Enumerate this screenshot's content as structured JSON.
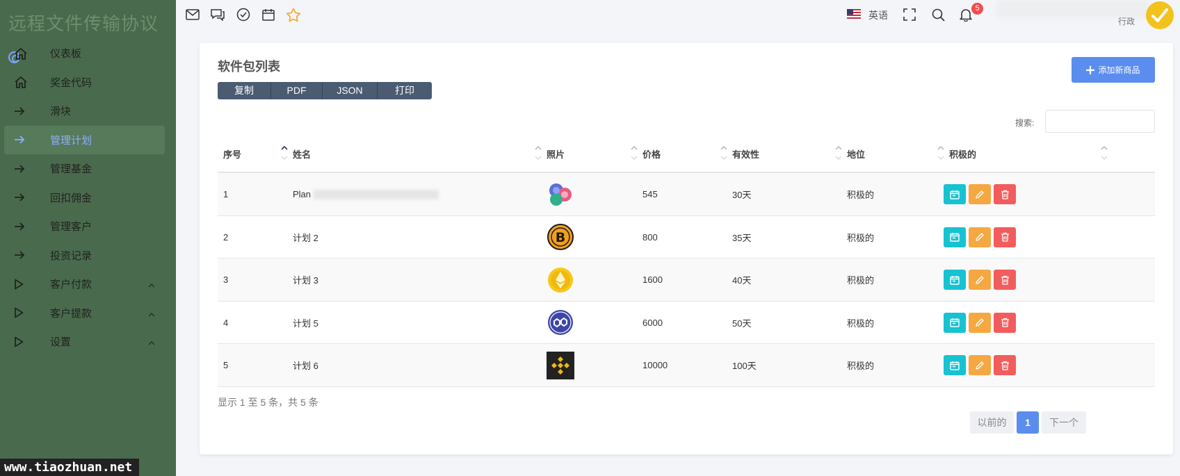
{
  "app": {
    "brand": "远程文件传输协议",
    "watermark": "www.tiaozhuan.net"
  },
  "sidebar": {
    "items": [
      {
        "label": "仪表板",
        "icon": "home-icon",
        "active": false,
        "caret": false
      },
      {
        "label": "奖金代码",
        "icon": "home-icon",
        "active": false,
        "caret": false
      },
      {
        "label": "滑块",
        "icon": "arrow-right-icon",
        "active": false,
        "caret": false
      },
      {
        "label": "管理计划",
        "icon": "arrow-right-icon",
        "active": true,
        "caret": false
      },
      {
        "label": "管理基金",
        "icon": "arrow-right-icon",
        "active": false,
        "caret": false
      },
      {
        "label": "回扣佣金",
        "icon": "arrow-right-icon",
        "active": false,
        "caret": false
      },
      {
        "label": "管理客户",
        "icon": "arrow-right-icon",
        "active": false,
        "caret": false
      },
      {
        "label": "投资记录",
        "icon": "arrow-right-icon",
        "active": false,
        "caret": false
      },
      {
        "label": "客户付款",
        "icon": "play-icon",
        "active": false,
        "caret": true
      },
      {
        "label": "客户提款",
        "icon": "play-icon",
        "active": false,
        "caret": true
      },
      {
        "label": "设置",
        "icon": "play-icon",
        "active": false,
        "caret": true
      }
    ]
  },
  "topbar": {
    "icons": [
      "mail-icon",
      "chat-icon",
      "check-circle-icon",
      "calendar-icon",
      "star-icon"
    ],
    "language": "英语",
    "notification_count": "5",
    "user_role": "行政"
  },
  "page": {
    "title": "软件包列表",
    "export_buttons": [
      "复制",
      "PDF",
      "JSON",
      "打印"
    ],
    "add_button": "添加新商品",
    "search_label": "搜索:",
    "search_value": ""
  },
  "table": {
    "columns": [
      "序号",
      "姓名",
      "照片",
      "价格",
      "有效性",
      "地位",
      "积极的"
    ],
    "rows": [
      {
        "id": "1",
        "name": "Plan",
        "name_redacted": true,
        "photo": "gems-coin",
        "price": "545",
        "validity": "30天",
        "status": "积极的"
      },
      {
        "id": "2",
        "name": "计划 2",
        "name_redacted": false,
        "photo": "bitcoin-coin",
        "price": "800",
        "validity": "35天",
        "status": "积极的"
      },
      {
        "id": "3",
        "name": "计划 3",
        "name_redacted": false,
        "photo": "ethereum-coin",
        "price": "1600",
        "validity": "40天",
        "status": "积极的"
      },
      {
        "id": "4",
        "name": "计划 5",
        "name_redacted": false,
        "photo": "polygon-coin",
        "price": "6000",
        "validity": "50天",
        "status": "积极的"
      },
      {
        "id": "5",
        "name": "计划 6",
        "name_redacted": false,
        "photo": "binance-coin",
        "price": "10000",
        "validity": "100天",
        "status": "积极的"
      }
    ]
  },
  "footer": {
    "info": "显示 1 至 5 条，共 5 条",
    "prev": "以前的",
    "current_page": "1",
    "next": "下一个"
  },
  "colors": {
    "sidebar_bg": "#4a6a4d",
    "accent": "#5b8def",
    "detail": "#17c2d1",
    "edit": "#f5a842",
    "delete": "#f25c5c",
    "badge": "#f44c4c"
  }
}
